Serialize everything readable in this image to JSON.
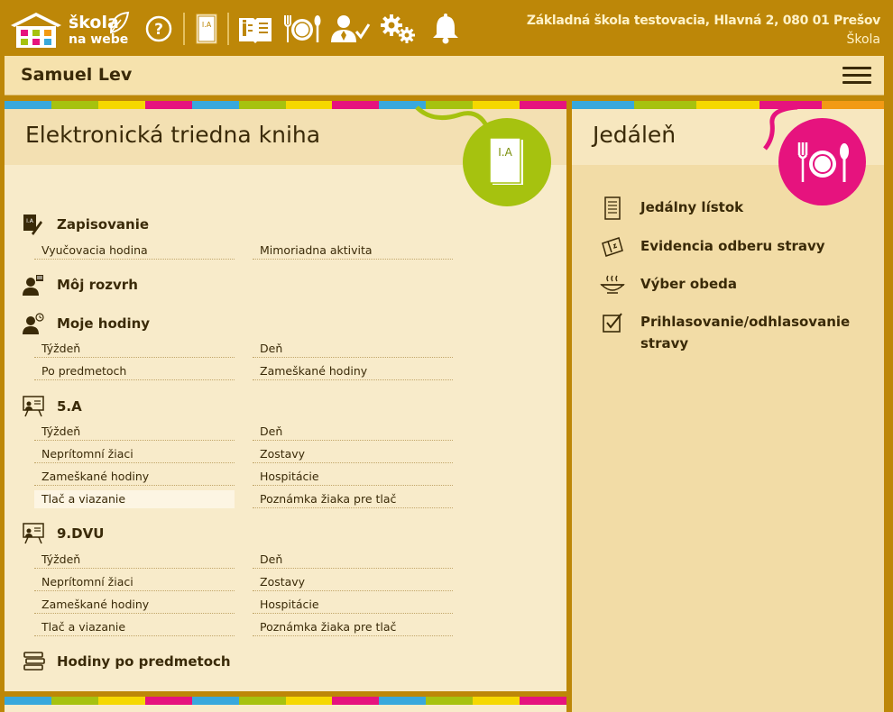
{
  "logo": {
    "line1": "škola",
    "line2": "na webe"
  },
  "school": {
    "name": "Základná škola testovacia, Hlavná 2, 080 01 Prešov",
    "type": "Škola"
  },
  "user": {
    "name": "Samuel Lev"
  },
  "toolbar": {
    "icons": [
      "help-icon",
      "class-book-icon",
      "grades-book-icon",
      "cafeteria-icon",
      "attendance-icon",
      "settings-icon",
      "notifications-icon"
    ],
    "class_book_label": "I.A"
  },
  "class_book": {
    "title": "Elektronická triedna kniha",
    "circle_label": "I.A",
    "sections": [
      {
        "title": "Zapisovanie",
        "icon": "write-icon",
        "links": [
          [
            "Vyučovacia hodina",
            "Mimoriadna aktivita"
          ]
        ]
      },
      {
        "title": "Môj rozvrh",
        "icon": "teacher-schedule-icon",
        "links": []
      },
      {
        "title": "Moje hodiny",
        "icon": "teacher-clock-icon",
        "links": [
          [
            "Týždeň",
            "Deň"
          ],
          [
            "Po predmetoch",
            "Zameškané hodiny"
          ]
        ]
      },
      {
        "title": "5.A",
        "icon": "classroom-board-icon",
        "links": [
          [
            "Týždeň",
            "Deň"
          ],
          [
            "Neprítomní žiaci",
            "Zostavy"
          ],
          [
            "Zameškané hodiny",
            "Hospitácie"
          ],
          [
            "Tlač a viazanie",
            "Poznámka žiaka pre tlač"
          ]
        ]
      },
      {
        "title": "9.DVU",
        "icon": "classroom-board-icon",
        "links": [
          [
            "Týždeň",
            "Deň"
          ],
          [
            "Neprítomní žiaci",
            "Zostavy"
          ],
          [
            "Zameškané hodiny",
            "Hospitácie"
          ],
          [
            "Tlač a viazanie",
            "Poznámka žiaka pre tlač"
          ]
        ]
      },
      {
        "title": "Hodiny po predmetoch",
        "icon": "books-stack-icon",
        "links": []
      }
    ]
  },
  "cafeteria": {
    "title": "Jedáleň",
    "items": [
      {
        "label": "Jedálny lístok",
        "icon": "menu-list-icon"
      },
      {
        "label": "Evidencia odberu stravy",
        "icon": "card-swipe-icon"
      },
      {
        "label": "Výber obeda",
        "icon": "hot-dish-icon"
      },
      {
        "label": "Prihlasovanie/odhlasovanie stravy",
        "icon": "checkbox-icon"
      }
    ]
  },
  "colors": {
    "background": "#bd8708",
    "panel": "#f8ebca",
    "green": "#a6c20f",
    "pink": "#e6137e",
    "blue": "#38a8dc",
    "yellow": "#f5d800",
    "orange": "#f29a14",
    "stripes": [
      "#38a8dc",
      "#a6c20f",
      "#f5d800",
      "#e6137e"
    ]
  }
}
